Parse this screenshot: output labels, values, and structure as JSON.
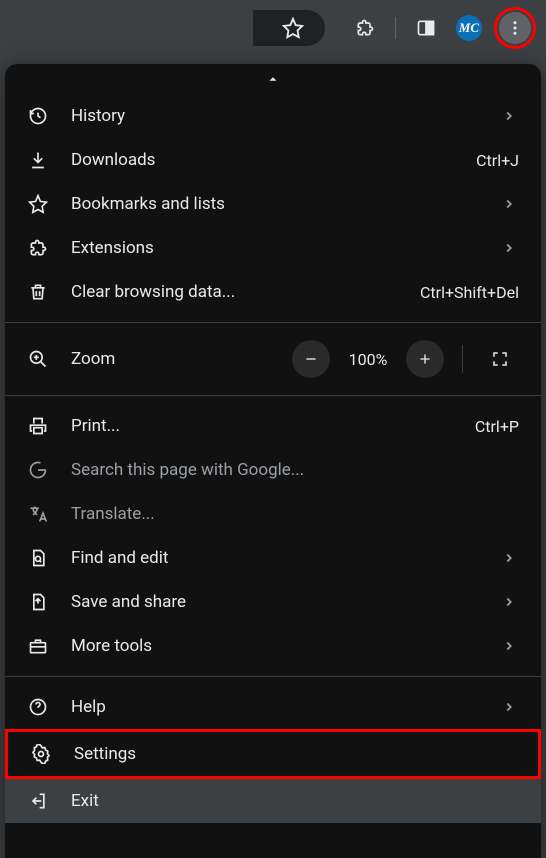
{
  "toolbar": {
    "profile_initials": "MC"
  },
  "menu": {
    "history": {
      "label": "History"
    },
    "downloads": {
      "label": "Downloads",
      "shortcut": "Ctrl+J"
    },
    "bookmarks": {
      "label": "Bookmarks and lists"
    },
    "extensions": {
      "label": "Extensions"
    },
    "clear_data": {
      "label": "Clear browsing data...",
      "shortcut": "Ctrl+Shift+Del"
    },
    "zoom": {
      "label": "Zoom",
      "value": "100%"
    },
    "print": {
      "label": "Print...",
      "shortcut": "Ctrl+P"
    },
    "search_page": {
      "label": "Search this page with Google..."
    },
    "translate": {
      "label": "Translate..."
    },
    "find_edit": {
      "label": "Find and edit"
    },
    "save_share": {
      "label": "Save and share"
    },
    "more_tools": {
      "label": "More tools"
    },
    "help": {
      "label": "Help"
    },
    "settings": {
      "label": "Settings"
    },
    "exit": {
      "label": "Exit"
    }
  }
}
